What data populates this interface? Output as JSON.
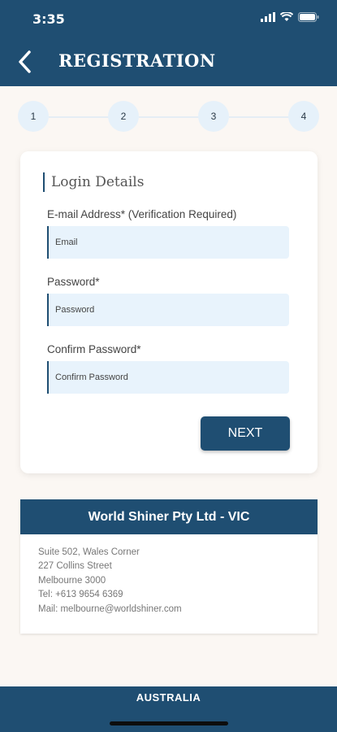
{
  "status_bar": {
    "time": "3:35"
  },
  "header": {
    "title": "REGISTRATION",
    "back_icon": "chevron-left-icon"
  },
  "stepper": {
    "steps": [
      "1",
      "2",
      "3",
      "4"
    ],
    "current": 1
  },
  "login_details": {
    "heading": "Login Details",
    "email": {
      "label": "E-mail Address* (Verification Required)",
      "placeholder": "Email"
    },
    "password": {
      "label": "Password*",
      "placeholder": "Password"
    },
    "confirm_password": {
      "label": "Confirm Password*",
      "placeholder": "Confirm Password"
    },
    "next_label": "NEXT"
  },
  "office": {
    "name": "World Shiner Pty Ltd - VIC",
    "lines": [
      "Suite 502, Wales Corner",
      "227 Collins Street",
      "Melbourne 3000",
      "Tel: +613 9654 6369",
      "Mail: melbourne@worldshiner.com"
    ]
  },
  "footer": {
    "country": "AUSTRALIA"
  },
  "colors": {
    "primary": "#1f4e72",
    "input_bg": "#e8f3fc",
    "page_bg": "#fbf7f3"
  }
}
